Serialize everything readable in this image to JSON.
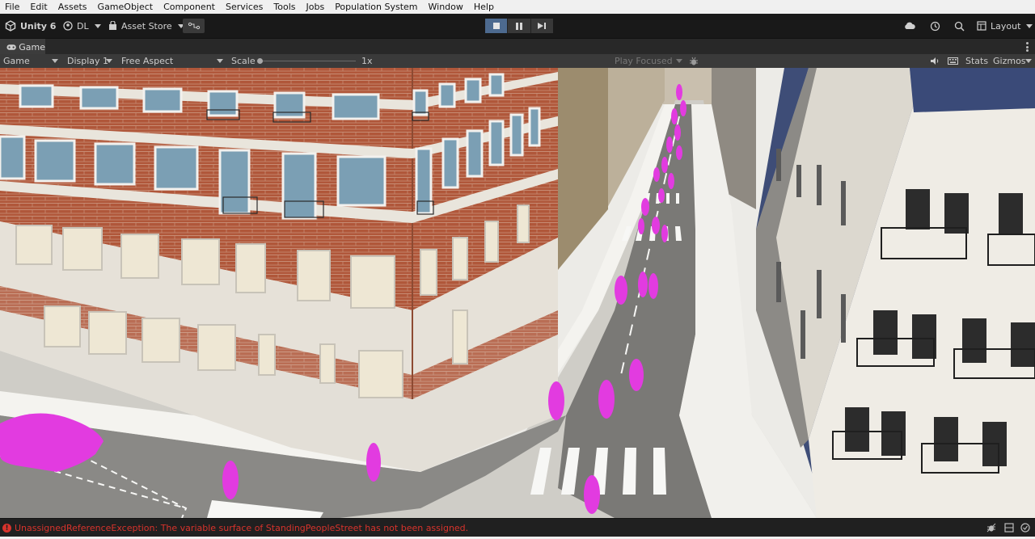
{
  "menu": [
    "File",
    "Edit",
    "Assets",
    "GameObject",
    "Component",
    "Services",
    "Tools",
    "Jobs",
    "Population System",
    "Window",
    "Help"
  ],
  "toolbar": {
    "app_label": "Unity 6",
    "account_label": "DL",
    "asset_store_label": "Asset Store",
    "layout_label": "Layout"
  },
  "tab": {
    "label": "Game"
  },
  "gamebar": {
    "mode_label": "Game",
    "display_label": "Display 1",
    "aspect_label": "Free Aspect",
    "scale_label": "Scale",
    "scale_value": "1x",
    "play_focused_label": "Play Focused",
    "stats_label": "Stats",
    "gizmos_label": "Gizmos"
  },
  "status": {
    "error_message": "UnassignedReferenceException: The variable surface of StandingPeopleStreet has not been assigned."
  },
  "colors": {
    "accent_play": "#4d6a8f",
    "error": "#d8332c",
    "agents": "#e23be0"
  },
  "icons": [
    "unity-logo-icon",
    "account-icon",
    "asset-store-icon",
    "version-control-icon",
    "stop-icon",
    "pause-icon",
    "step-icon",
    "cloud-icon",
    "history-icon",
    "search-icon",
    "layout-icon",
    "game-tab-icon",
    "debug-icon",
    "mute-icon",
    "keyboard-icon",
    "error-icon",
    "bug-icon",
    "build-icon",
    "check-icon"
  ]
}
